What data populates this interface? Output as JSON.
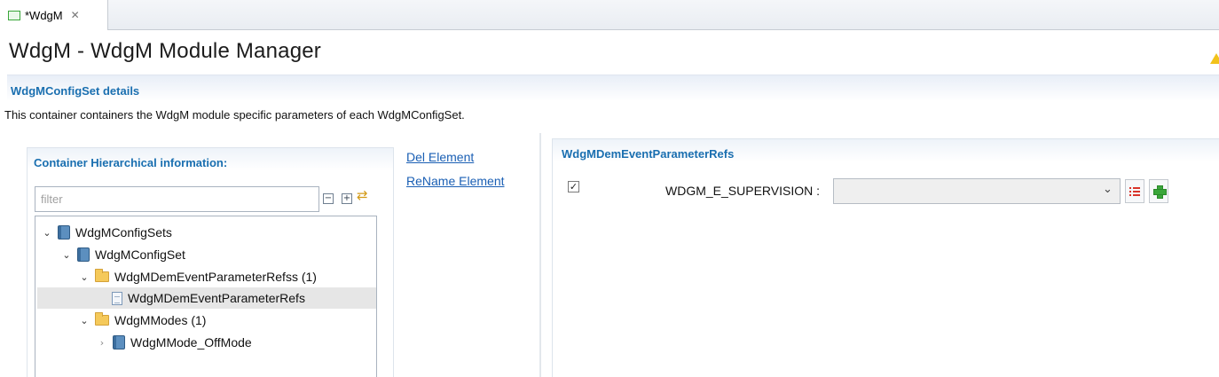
{
  "editor_tab": {
    "label": "*WdgM",
    "close_glyph": "✕"
  },
  "page": {
    "title": "WdgM - WdgM Module Manager"
  },
  "section": {
    "title": "WdgMConfigSet details",
    "description": "This container containers the WdgM module specific parameters of each WdgMConfigSet."
  },
  "left_panel": {
    "title": "Container Hierarchical information:",
    "filter": {
      "placeholder": "filter",
      "value": ""
    },
    "toolbar": {
      "collapse_glyph": "−",
      "expand_glyph": "+",
      "sync_glyph": "⇄"
    },
    "tree": [
      {
        "label": "WdgMConfigSets",
        "icon": "config-book-icon",
        "expanded": true
      },
      {
        "label": "WdgMConfigSet",
        "icon": "config-book-icon",
        "expanded": true
      },
      {
        "label": "WdgMDemEventParameterRefss (1)",
        "icon": "folder-icon",
        "expanded": true
      },
      {
        "label": "WdgMDemEventParameterRefs",
        "icon": "document-icon",
        "selected": true
      },
      {
        "label": "WdgMModes (1)",
        "icon": "folder-icon",
        "expanded": true
      },
      {
        "label": "WdgMMode_OffMode",
        "icon": "config-book-icon",
        "expanded": false
      }
    ],
    "chevrons": {
      "expanded": "⌄",
      "collapsed": "›"
    }
  },
  "actions": {
    "delete_label": "Del Element",
    "rename_label": "ReName Element"
  },
  "right_panel": {
    "title": "WdgMDemEventParameterRefs",
    "param": {
      "checked": true,
      "check_glyph": "✓",
      "label": "WDGM_E_SUPERVISION :",
      "value": "",
      "arrow_glyph": "⌄"
    }
  },
  "colors": {
    "accent": "#1a6fb0",
    "link": "#1a5fb4",
    "warning": "#f2c21b",
    "add": "#3aa63a",
    "list": "#d9342b"
  }
}
